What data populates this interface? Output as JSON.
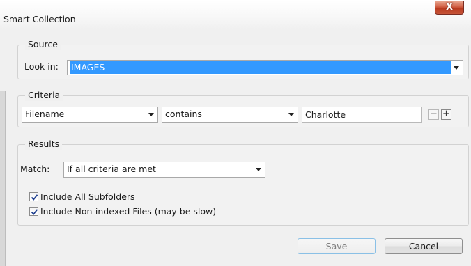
{
  "window": {
    "title": "Smart Collection",
    "close_glyph": "X"
  },
  "source": {
    "group_label": "Source",
    "look_in_label": "Look in:",
    "look_in_value": "IMAGES"
  },
  "criteria": {
    "group_label": "Criteria",
    "field_value": "Filename",
    "operator_value": "contains",
    "text_value": "Charlotte",
    "remove_glyph": "−",
    "add_glyph": "+"
  },
  "results": {
    "group_label": "Results",
    "match_label": "Match:",
    "match_value": "If all criteria are met",
    "include_subfolders_label": "Include All Subfolders",
    "include_subfolders_checked": true,
    "include_nonindexed_label": "Include Non-indexed Files (may be slow)",
    "include_nonindexed_checked": true
  },
  "buttons": {
    "save_label": "Save",
    "cancel_label": "Cancel"
  },
  "colors": {
    "selection": "#3399ff",
    "close_button": "#c7563a",
    "default_button_border": "#8ac0e6"
  },
  "icons": {
    "dropdown": "chevron-down-icon",
    "close": "close-icon",
    "checkmark": "checkmark-icon"
  }
}
